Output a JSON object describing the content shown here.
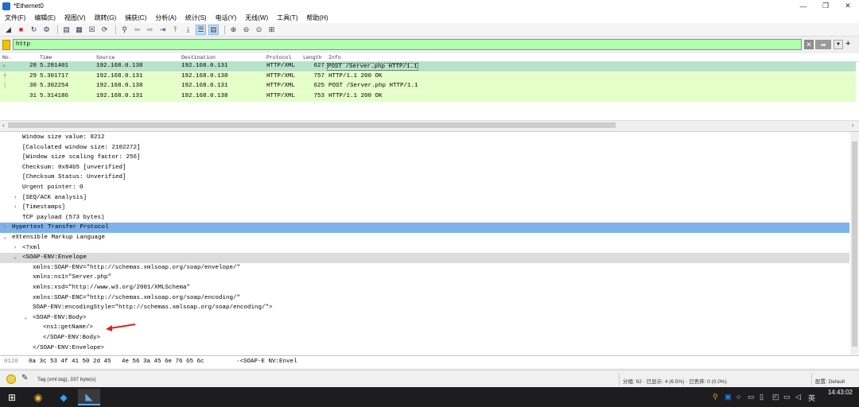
{
  "window": {
    "title": "*Ethernet0",
    "controls": [
      "—",
      "❐",
      "✕"
    ]
  },
  "menu": [
    "文件(F)",
    "编辑(E)",
    "视图(V)",
    "跳转(G)",
    "捕获(C)",
    "分析(A)",
    "统计(S)",
    "电话(Y)",
    "无线(W)",
    "工具(T)",
    "帮助(H)"
  ],
  "filter": {
    "value": "http"
  },
  "packet_list": {
    "columns": [
      "No.",
      "Time",
      "Source",
      "Destination",
      "Protocol",
      "Length",
      "Info"
    ],
    "rows": [
      {
        "no": "28",
        "time": "5.281401",
        "src": "192.168.0.138",
        "dst": "192.168.0.131",
        "proto": "HTTP/XML",
        "len": "627",
        "info": "POST /Server.php HTTP/1.1"
      },
      {
        "no": "29",
        "time": "5.301717",
        "src": "192.168.0.131",
        "dst": "192.168.0.138",
        "proto": "HTTP/XML",
        "len": "757",
        "info": "HTTP/1.1 200 OK"
      },
      {
        "no": "30",
        "time": "5.302254",
        "src": "192.168.0.138",
        "dst": "192.168.0.131",
        "proto": "HTTP/XML",
        "len": "625",
        "info": "POST /Server.php HTTP/1.1"
      },
      {
        "no": "31",
        "time": "5.314186",
        "src": "192.168.0.131",
        "dst": "192.168.0.138",
        "proto": "HTTP/XML",
        "len": "753",
        "info": "HTTP/1.1 200 OK"
      }
    ]
  },
  "detail": {
    "lines": [
      "Window size value: 8212",
      "[Calculated window size: 2102272]",
      "[Window size scaling factor: 256]",
      "Checksum: 0x84b5 [unverified]",
      "[Checksum Status: Unverified]",
      "Urgent pointer: 0",
      "[SEQ/ACK analysis]",
      "[Timestamps]",
      "TCP payload (573 bytes)",
      "Hypertext Transfer Protocol",
      "eXtensible Markup Language",
      "<?xml",
      "<SOAP-ENV:Envelope",
      "xmlns:SOAP-ENV=\"http://schemas.xmlsoap.org/soap/envelope/\"",
      "xmlns:ns1=\"Server.php\"",
      "xmlns:xsd=\"http://www.w3.org/2001/XMLSchema\"",
      "xmlns:SOAP-ENC=\"http://schemas.xmlsoap.org/soap/encoding/\"",
      "SOAP-ENV:encodingStyle=\"http://schemas.xmlsoap.org/soap/encoding/\">",
      "<SOAP-ENV:Body>",
      "<ns1:getName/>",
      "</SOAP-ENV:Body>",
      "</SOAP-ENV:Envelope>"
    ]
  },
  "hex": {
    "offset": "0120",
    "bytes": "0a 3c 53 4f 41 50 2d 45   4e 56 3a 45 6e 76 65 6c",
    "ascii": "·<SOAP-E NV:Envel"
  },
  "status": {
    "field": "Tag (xml.tag), 337 byte(s)",
    "packets": "分组: 62 · 已显示: 4 (6.5%) · 已丢弃: 0 (0.0%)",
    "profile": "配置: Default"
  },
  "taskbar": {
    "time": "14:43:02",
    "lang": "英"
  },
  "colors": {
    "row": "#e4ffc7",
    "selected_row": "#b8e3c9",
    "filter_ok": "#afffaf",
    "highlight": "#7fb2ea"
  }
}
